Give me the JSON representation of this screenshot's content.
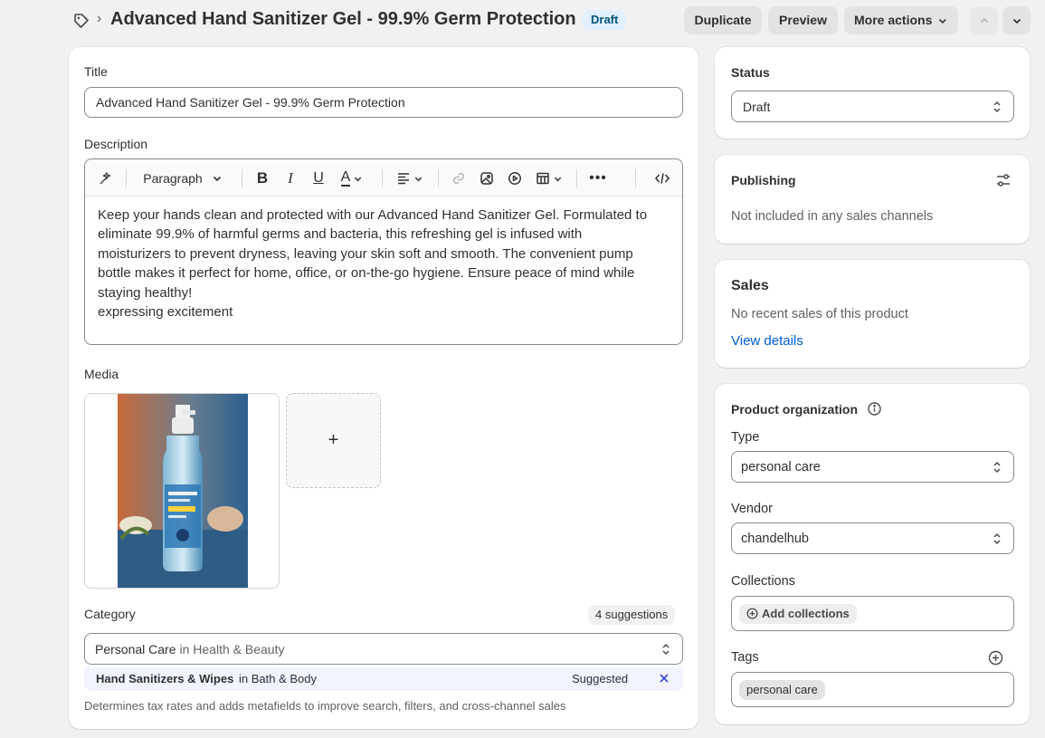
{
  "header": {
    "title": "Advanced Hand Sanitizer Gel - 99.9% Germ Protection",
    "status_badge": "Draft",
    "duplicate_label": "Duplicate",
    "preview_label": "Preview",
    "more_actions_label": "More actions"
  },
  "main": {
    "title_label": "Title",
    "title_value": "Advanced Hand Sanitizer Gel - 99.9% Germ Protection",
    "description_label": "Description",
    "toolbar": {
      "paragraph_label": "Paragraph"
    },
    "description_lines": [
      "Keep your hands clean and protected with our Advanced Hand Sanitizer Gel. Formulated to",
      "eliminate 99.9% of harmful germs and bacteria, this refreshing gel is infused with",
      "moisturizers to prevent dryness, leaving your skin soft and smooth. The convenient pump",
      "bottle makes it perfect for home, office, or on-the-go hygiene. Ensure peace of mind while",
      "staying healthy!",
      "expressing excitement"
    ],
    "media_label": "Media",
    "media_add_symbol": "+",
    "category_label": "Category",
    "category_suggestions": "4 suggestions",
    "category_value": "Personal Care",
    "category_in": "in Health & Beauty",
    "suggestion_name": "Hand Sanitizers & Wipes",
    "suggestion_in": "in Bath & Body",
    "suggestion_status": "Suggested",
    "category_help": "Determines tax rates and adds metafields to improve search, filters, and cross-channel sales"
  },
  "status_card": {
    "label": "Status",
    "value": "Draft"
  },
  "publishing_card": {
    "label": "Publishing",
    "text": "Not included in any sales channels"
  },
  "sales_card": {
    "label": "Sales",
    "text": "No recent sales of this product",
    "link": "View details"
  },
  "org_card": {
    "label": "Product organization",
    "type_label": "Type",
    "type_value": "personal care",
    "vendor_label": "Vendor",
    "vendor_value": "chandelhub",
    "collections_label": "Collections",
    "add_collections_label": "Add collections",
    "tags_label": "Tags",
    "tags": [
      "personal care"
    ]
  },
  "colors": {
    "accent": "#005bd3",
    "badge_bg": "#e0f0ff",
    "badge_text": "#00527c",
    "page_bg": "#f1f1f1"
  }
}
